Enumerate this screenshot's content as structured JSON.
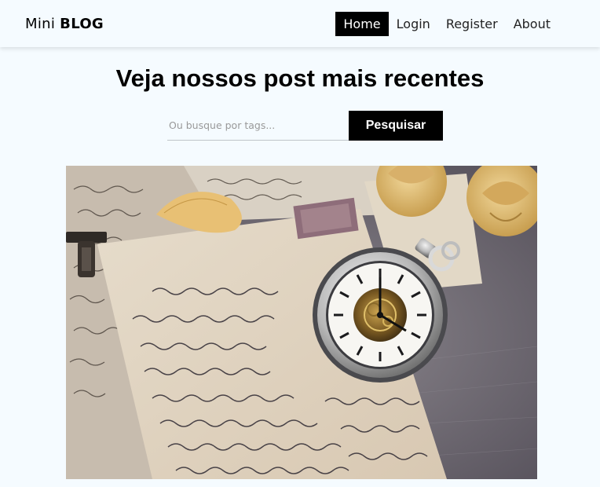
{
  "navbar": {
    "brand_light": "Mini",
    "brand_bold": "BLOG",
    "links": [
      "Home",
      "Login",
      "Register",
      "About"
    ]
  },
  "home": {
    "title": "Veja nossos post mais recentes",
    "search_placeholder": "Ou busque por tags...",
    "search_button": "Pesquisar"
  },
  "post": {
    "image_subject": "vintage pocket watch on handwritten letters with dried roses",
    "letter_text": [
      "Sept. 1-1864",
      "His day, sold and delivered",
      "to Ephriam W. Parker",
      "One hundred and",
      "for three hundred",
      "four dollars and",
      "fine cows for sixty",
      "four year olds",
      "One hundred and",
      "for one hundred",
      "One hundred and",
      "dollars. Received pay in",
      "goods and cash in good"
    ]
  },
  "colors": {
    "background": "#f5fbff",
    "accent": "#000000",
    "accent_text": "#ffffff"
  }
}
